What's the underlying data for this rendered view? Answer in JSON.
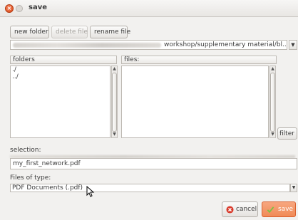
{
  "window": {
    "title": "save",
    "close_glyph": "×"
  },
  "toolbar": {
    "new_folder": "new folder",
    "delete_file": "delete file",
    "rename_file": "rename file"
  },
  "path": {
    "visible_text": "workshop/supplementary material/bl...",
    "dropdown_glyph": "▼"
  },
  "folders": {
    "header": "folders",
    "items": [
      "./",
      "../"
    ]
  },
  "files": {
    "header": "files:",
    "items": []
  },
  "filter_label": "filter",
  "selection": {
    "label": "selection:",
    "value": "my_first_network.pdf"
  },
  "filetype": {
    "label": "Files of type:",
    "value": "PDF Documents (.pdf)",
    "dropdown_glyph": "▼"
  },
  "actions": {
    "cancel": "cancel",
    "save": "save"
  },
  "colors": {
    "accent": "#f08a57",
    "close": "#dd4814"
  },
  "icons": {
    "cancel": "cancel-icon",
    "save": "checkmark-icon"
  }
}
